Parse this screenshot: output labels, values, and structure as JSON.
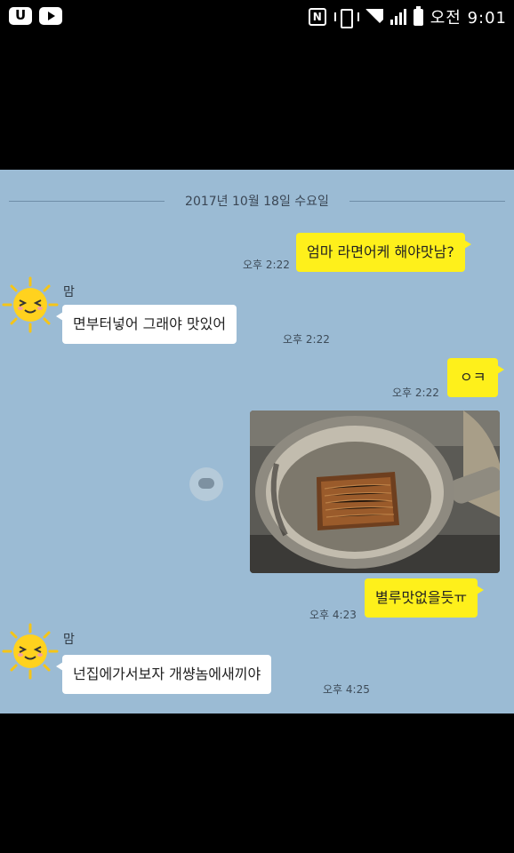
{
  "status_bar": {
    "left_icons": [
      "app-u-icon",
      "youtube-icon"
    ],
    "right_icons": [
      "nfc-icon",
      "vibrate-icon",
      "wifi-icon",
      "signal-icon",
      "battery-icon"
    ],
    "clock": "오전 9:01"
  },
  "chat": {
    "date_divider": "2017년 10월 18일 수요일",
    "background_color": "#9bbbd4",
    "my_bubble_color": "#fef01b",
    "their_bubble_color": "#ffffff",
    "messages": [
      {
        "from": "me",
        "text": "엄마 라면어케 해야맛남?",
        "time": "오후 2:22"
      },
      {
        "from": "them",
        "sender": "맘",
        "text": "면부터넣어  그래야 맛있어",
        "time": "오후 2:22"
      },
      {
        "from": "me",
        "text": "ㅇㅋ",
        "time": "오후 2:22"
      },
      {
        "from": "me",
        "type": "photo"
      },
      {
        "from": "me",
        "text": "별루맛없을듯ㅠ",
        "time": "오후 4:23"
      },
      {
        "from": "them",
        "sender": "맘",
        "text": "넌집에가서보자 개썅놈에새끼야",
        "time": "오후 4:25"
      }
    ]
  }
}
